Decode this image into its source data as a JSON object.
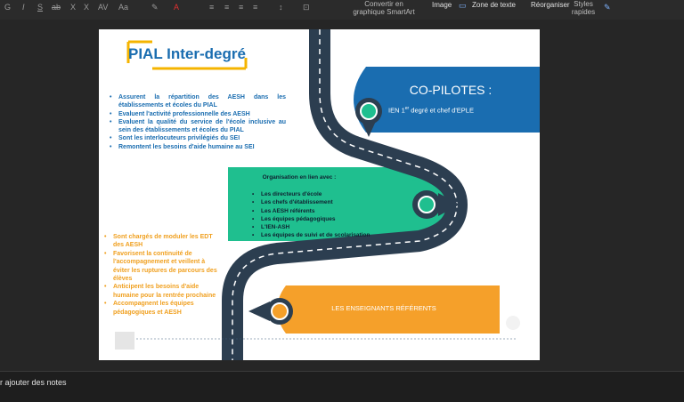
{
  "toolbar": {
    "format_glyphs": [
      "G",
      "I",
      "S",
      "ab",
      "X",
      "X",
      "AV",
      "Aa"
    ],
    "convert_smartart": "Convertir en graphique SmartArt",
    "image": "Image",
    "text_box": "Zone de texte",
    "reorganize": "Réorganiser",
    "quick_styles": "Styles rapides"
  },
  "slide": {
    "title": "PIAL Inter-degré",
    "copilotes_title": "CO-PILOTES :",
    "copilotes_prefix": "IEN 1",
    "copilotes_sup": "er",
    "copilotes_suffix": " degré et chef d'EPLE",
    "blue_list": [
      "Assurent la répartition des AESH dans les établissements et écoles du PIAL",
      "Evaluent l'activité professionnelle des AESH",
      "Evaluent la qualité du service de l'école inclusive au sein des établissements et écoles du PIAL",
      "Sont les interlocuteurs privilégiés du SEI",
      "Remontent les besoins d'aide humaine au SEI"
    ],
    "green_box_title": "Organisation en lien avec :",
    "green_list": [
      "Les directeurs d'école",
      "Les chefs d'établissement",
      "Les AESH référents",
      "Les équipes pédagogiques",
      "L'IEN-ASH",
      "Les équipes de suivi et de scolarisation"
    ],
    "orange_list": [
      "Sont chargés de moduler les EDT des AESH",
      "Favorisent la continuité de l'accompagnement et veillent à éviter les ruptures de parcours des élèves",
      "Anticipent les besoins d'aide humaine pour la rentrée prochaine",
      "Accompagnent les équipes pédagogiques et AESH"
    ],
    "referents_label": "LES ENSEIGNANTS RÉFÉRENTS"
  },
  "notes": {
    "placeholder": "r ajouter des notes"
  },
  "colors": {
    "road": "#2c3e50",
    "blue": "#1a6db0",
    "teal": "#1fbf8f",
    "orange": "#f0a020",
    "title_underline": "#f5b400"
  }
}
